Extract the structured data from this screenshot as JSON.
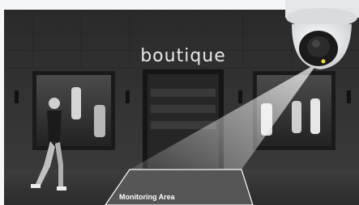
{
  "scene": {
    "store_sign": "boutique",
    "area_label": "Monitoring Area",
    "colors": {
      "accent_led": "#ffdd33",
      "zone_fill": "#5a5a5a"
    }
  }
}
